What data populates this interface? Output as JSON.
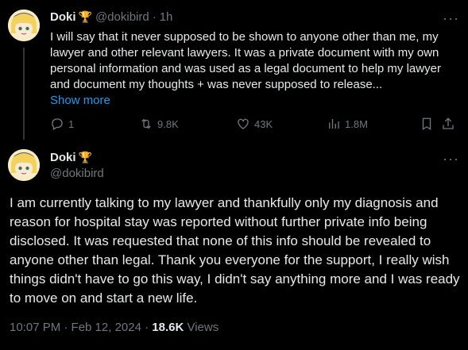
{
  "tweet1": {
    "author_name": "Doki",
    "badge": "🏆",
    "handle": "@dokibird",
    "separator": "·",
    "time": "1h",
    "text": "I will say that it never supposed to be shown to anyone other than me, my lawyer and other relevant lawyers. It was a private document with my own personal information and was used as a legal document to help my lawyer and document my thoughts + was never supposed to release...",
    "show_more_label": "Show more",
    "actions": {
      "replies": "1",
      "reposts": "9.8K",
      "likes": "43K",
      "views": "1.8M"
    }
  },
  "tweet2": {
    "author_name": "Doki",
    "badge": "🏆",
    "handle": "@dokibird",
    "text": "I am currently talking to my lawyer and thankfully only my diagnosis and reason for hospital stay was reported without further private info being disclosed. It was requested that none of this info should be revealed to anyone other than legal. Thank you everyone for the support, I really wish things didn't have to go this way, I didn't say anything more and I was ready to move on and start a new life.",
    "timestamp": "10:07 PM · Feb 12, 2024",
    "separator": "·",
    "views_count": "18.6K",
    "views_label": "Views"
  },
  "icons": [
    "more-icon",
    "reply-icon",
    "repost-icon",
    "like-icon",
    "views-icon",
    "bookmark-icon",
    "share-icon",
    "trophy-icon"
  ],
  "colors": {
    "background": "#000000",
    "text": "#e7e9ea",
    "muted": "#71767b",
    "link": "#1d9bf0",
    "thread_line": "#333639"
  }
}
